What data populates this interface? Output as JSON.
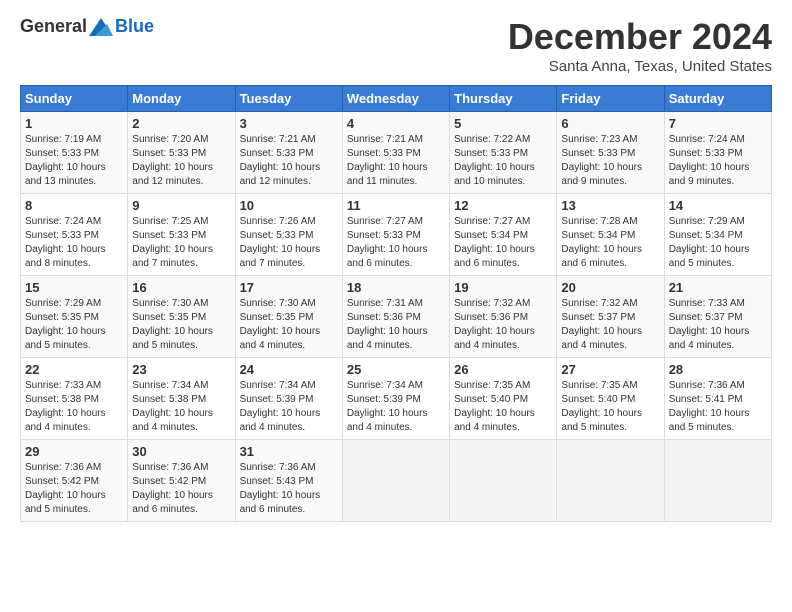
{
  "logo": {
    "general": "General",
    "blue": "Blue"
  },
  "title": "December 2024",
  "location": "Santa Anna, Texas, United States",
  "days_header": [
    "Sunday",
    "Monday",
    "Tuesday",
    "Wednesday",
    "Thursday",
    "Friday",
    "Saturday"
  ],
  "weeks": [
    [
      {
        "day": "1",
        "info": "Sunrise: 7:19 AM\nSunset: 5:33 PM\nDaylight: 10 hours\nand 13 minutes."
      },
      {
        "day": "2",
        "info": "Sunrise: 7:20 AM\nSunset: 5:33 PM\nDaylight: 10 hours\nand 12 minutes."
      },
      {
        "day": "3",
        "info": "Sunrise: 7:21 AM\nSunset: 5:33 PM\nDaylight: 10 hours\nand 12 minutes."
      },
      {
        "day": "4",
        "info": "Sunrise: 7:21 AM\nSunset: 5:33 PM\nDaylight: 10 hours\nand 11 minutes."
      },
      {
        "day": "5",
        "info": "Sunrise: 7:22 AM\nSunset: 5:33 PM\nDaylight: 10 hours\nand 10 minutes."
      },
      {
        "day": "6",
        "info": "Sunrise: 7:23 AM\nSunset: 5:33 PM\nDaylight: 10 hours\nand 9 minutes."
      },
      {
        "day": "7",
        "info": "Sunrise: 7:24 AM\nSunset: 5:33 PM\nDaylight: 10 hours\nand 9 minutes."
      }
    ],
    [
      {
        "day": "8",
        "info": "Sunrise: 7:24 AM\nSunset: 5:33 PM\nDaylight: 10 hours\nand 8 minutes."
      },
      {
        "day": "9",
        "info": "Sunrise: 7:25 AM\nSunset: 5:33 PM\nDaylight: 10 hours\nand 7 minutes."
      },
      {
        "day": "10",
        "info": "Sunrise: 7:26 AM\nSunset: 5:33 PM\nDaylight: 10 hours\nand 7 minutes."
      },
      {
        "day": "11",
        "info": "Sunrise: 7:27 AM\nSunset: 5:33 PM\nDaylight: 10 hours\nand 6 minutes."
      },
      {
        "day": "12",
        "info": "Sunrise: 7:27 AM\nSunset: 5:34 PM\nDaylight: 10 hours\nand 6 minutes."
      },
      {
        "day": "13",
        "info": "Sunrise: 7:28 AM\nSunset: 5:34 PM\nDaylight: 10 hours\nand 6 minutes."
      },
      {
        "day": "14",
        "info": "Sunrise: 7:29 AM\nSunset: 5:34 PM\nDaylight: 10 hours\nand 5 minutes."
      }
    ],
    [
      {
        "day": "15",
        "info": "Sunrise: 7:29 AM\nSunset: 5:35 PM\nDaylight: 10 hours\nand 5 minutes."
      },
      {
        "day": "16",
        "info": "Sunrise: 7:30 AM\nSunset: 5:35 PM\nDaylight: 10 hours\nand 5 minutes."
      },
      {
        "day": "17",
        "info": "Sunrise: 7:30 AM\nSunset: 5:35 PM\nDaylight: 10 hours\nand 4 minutes."
      },
      {
        "day": "18",
        "info": "Sunrise: 7:31 AM\nSunset: 5:36 PM\nDaylight: 10 hours\nand 4 minutes."
      },
      {
        "day": "19",
        "info": "Sunrise: 7:32 AM\nSunset: 5:36 PM\nDaylight: 10 hours\nand 4 minutes."
      },
      {
        "day": "20",
        "info": "Sunrise: 7:32 AM\nSunset: 5:37 PM\nDaylight: 10 hours\nand 4 minutes."
      },
      {
        "day": "21",
        "info": "Sunrise: 7:33 AM\nSunset: 5:37 PM\nDaylight: 10 hours\nand 4 minutes."
      }
    ],
    [
      {
        "day": "22",
        "info": "Sunrise: 7:33 AM\nSunset: 5:38 PM\nDaylight: 10 hours\nand 4 minutes."
      },
      {
        "day": "23",
        "info": "Sunrise: 7:34 AM\nSunset: 5:38 PM\nDaylight: 10 hours\nand 4 minutes."
      },
      {
        "day": "24",
        "info": "Sunrise: 7:34 AM\nSunset: 5:39 PM\nDaylight: 10 hours\nand 4 minutes."
      },
      {
        "day": "25",
        "info": "Sunrise: 7:34 AM\nSunset: 5:39 PM\nDaylight: 10 hours\nand 4 minutes."
      },
      {
        "day": "26",
        "info": "Sunrise: 7:35 AM\nSunset: 5:40 PM\nDaylight: 10 hours\nand 4 minutes."
      },
      {
        "day": "27",
        "info": "Sunrise: 7:35 AM\nSunset: 5:40 PM\nDaylight: 10 hours\nand 5 minutes."
      },
      {
        "day": "28",
        "info": "Sunrise: 7:36 AM\nSunset: 5:41 PM\nDaylight: 10 hours\nand 5 minutes."
      }
    ],
    [
      {
        "day": "29",
        "info": "Sunrise: 7:36 AM\nSunset: 5:42 PM\nDaylight: 10 hours\nand 5 minutes."
      },
      {
        "day": "30",
        "info": "Sunrise: 7:36 AM\nSunset: 5:42 PM\nDaylight: 10 hours\nand 6 minutes."
      },
      {
        "day": "31",
        "info": "Sunrise: 7:36 AM\nSunset: 5:43 PM\nDaylight: 10 hours\nand 6 minutes."
      },
      {
        "day": "",
        "info": ""
      },
      {
        "day": "",
        "info": ""
      },
      {
        "day": "",
        "info": ""
      },
      {
        "day": "",
        "info": ""
      }
    ]
  ]
}
